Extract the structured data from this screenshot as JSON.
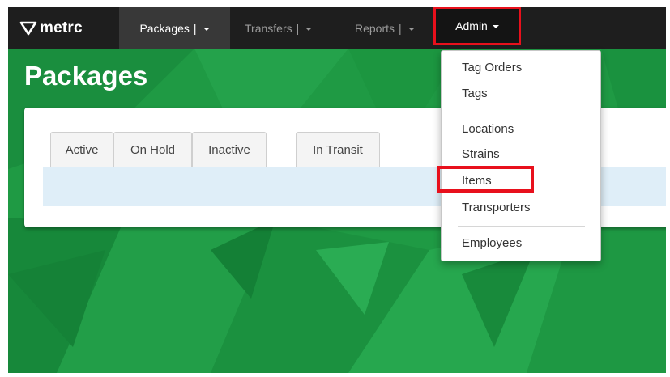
{
  "brand": {
    "name": "metrc",
    "icon": "metrc-logo-icon"
  },
  "navbar": {
    "items": [
      {
        "label": "Packages",
        "separator": "|"
      },
      {
        "label": "Transfers",
        "separator": "|"
      },
      {
        "label": "Reports",
        "separator": "|"
      },
      {
        "label": "Admin"
      }
    ],
    "active_item": "Packages",
    "highlight_color": "#e8101c"
  },
  "page": {
    "title": "Packages"
  },
  "tabs": [
    {
      "label": "Active"
    },
    {
      "label": "On Hold"
    },
    {
      "label": "Inactive"
    },
    {
      "label": "In Transit"
    }
  ],
  "tab_divider": "|",
  "admin_menu": {
    "items": [
      {
        "label": "Tag Orders"
      },
      {
        "label": "Tags"
      },
      {
        "label": "Locations"
      },
      {
        "label": "Strains"
      },
      {
        "label": "Items"
      },
      {
        "label": "Transporters"
      },
      {
        "label": "Employees"
      }
    ],
    "highlighted_item": "Items"
  },
  "colors": {
    "navbar_bg": "#1e1e1e",
    "background_green": "#1f9a44",
    "tab_strip": "#dfeef8"
  }
}
